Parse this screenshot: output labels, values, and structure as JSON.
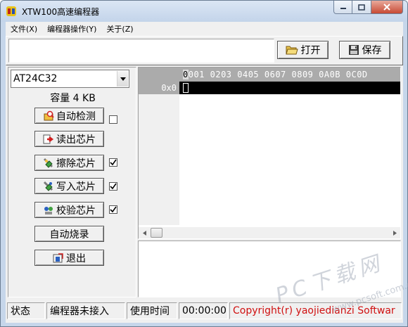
{
  "window": {
    "title": "XTW100高速编程器"
  },
  "menu": [
    "文件(X)",
    "编程器操作(Y)",
    "关于(Z)"
  ],
  "toolbar": {
    "path_value": "",
    "open_label": "打开",
    "save_label": "保存"
  },
  "chip": {
    "selected": "AT24C32",
    "capacity": "容量 4 KB"
  },
  "actions": [
    {
      "label": "自动检测",
      "icon": "auto-detect-icon",
      "checked": false,
      "has_checkbox": true
    },
    {
      "label": "读出芯片",
      "icon": "read-chip-icon",
      "has_checkbox": false
    },
    {
      "label": "擦除芯片",
      "icon": "erase-chip-icon",
      "checked": true,
      "has_checkbox": true
    },
    {
      "label": "写入芯片",
      "icon": "write-chip-icon",
      "checked": true,
      "has_checkbox": true
    },
    {
      "label": "校验芯片",
      "icon": "verify-chip-icon",
      "checked": true,
      "has_checkbox": true
    },
    {
      "label": "自动烧录",
      "icon": "",
      "has_checkbox": false
    },
    {
      "label": "退出",
      "icon": "exit-icon",
      "has_checkbox": false
    }
  ],
  "hex": {
    "first_col_char": "0",
    "columns_rest": "001 0203 0405 0607 0809 0A0B 0C0D",
    "row_address": "0x0"
  },
  "status": {
    "state_label": "状态",
    "connection": "编程器未接入",
    "time_label": "使用时间",
    "time_value": "00:00:00",
    "copyright": "Copyright(r) yaojiedianzi Softwar"
  },
  "watermark": {
    "text": "PC下载网",
    "url": "www.pcsoft.com.cn"
  },
  "colors": {
    "hex_header": "#ababab",
    "copyright": "#d01010",
    "titlebar": "#c3d4ea"
  }
}
